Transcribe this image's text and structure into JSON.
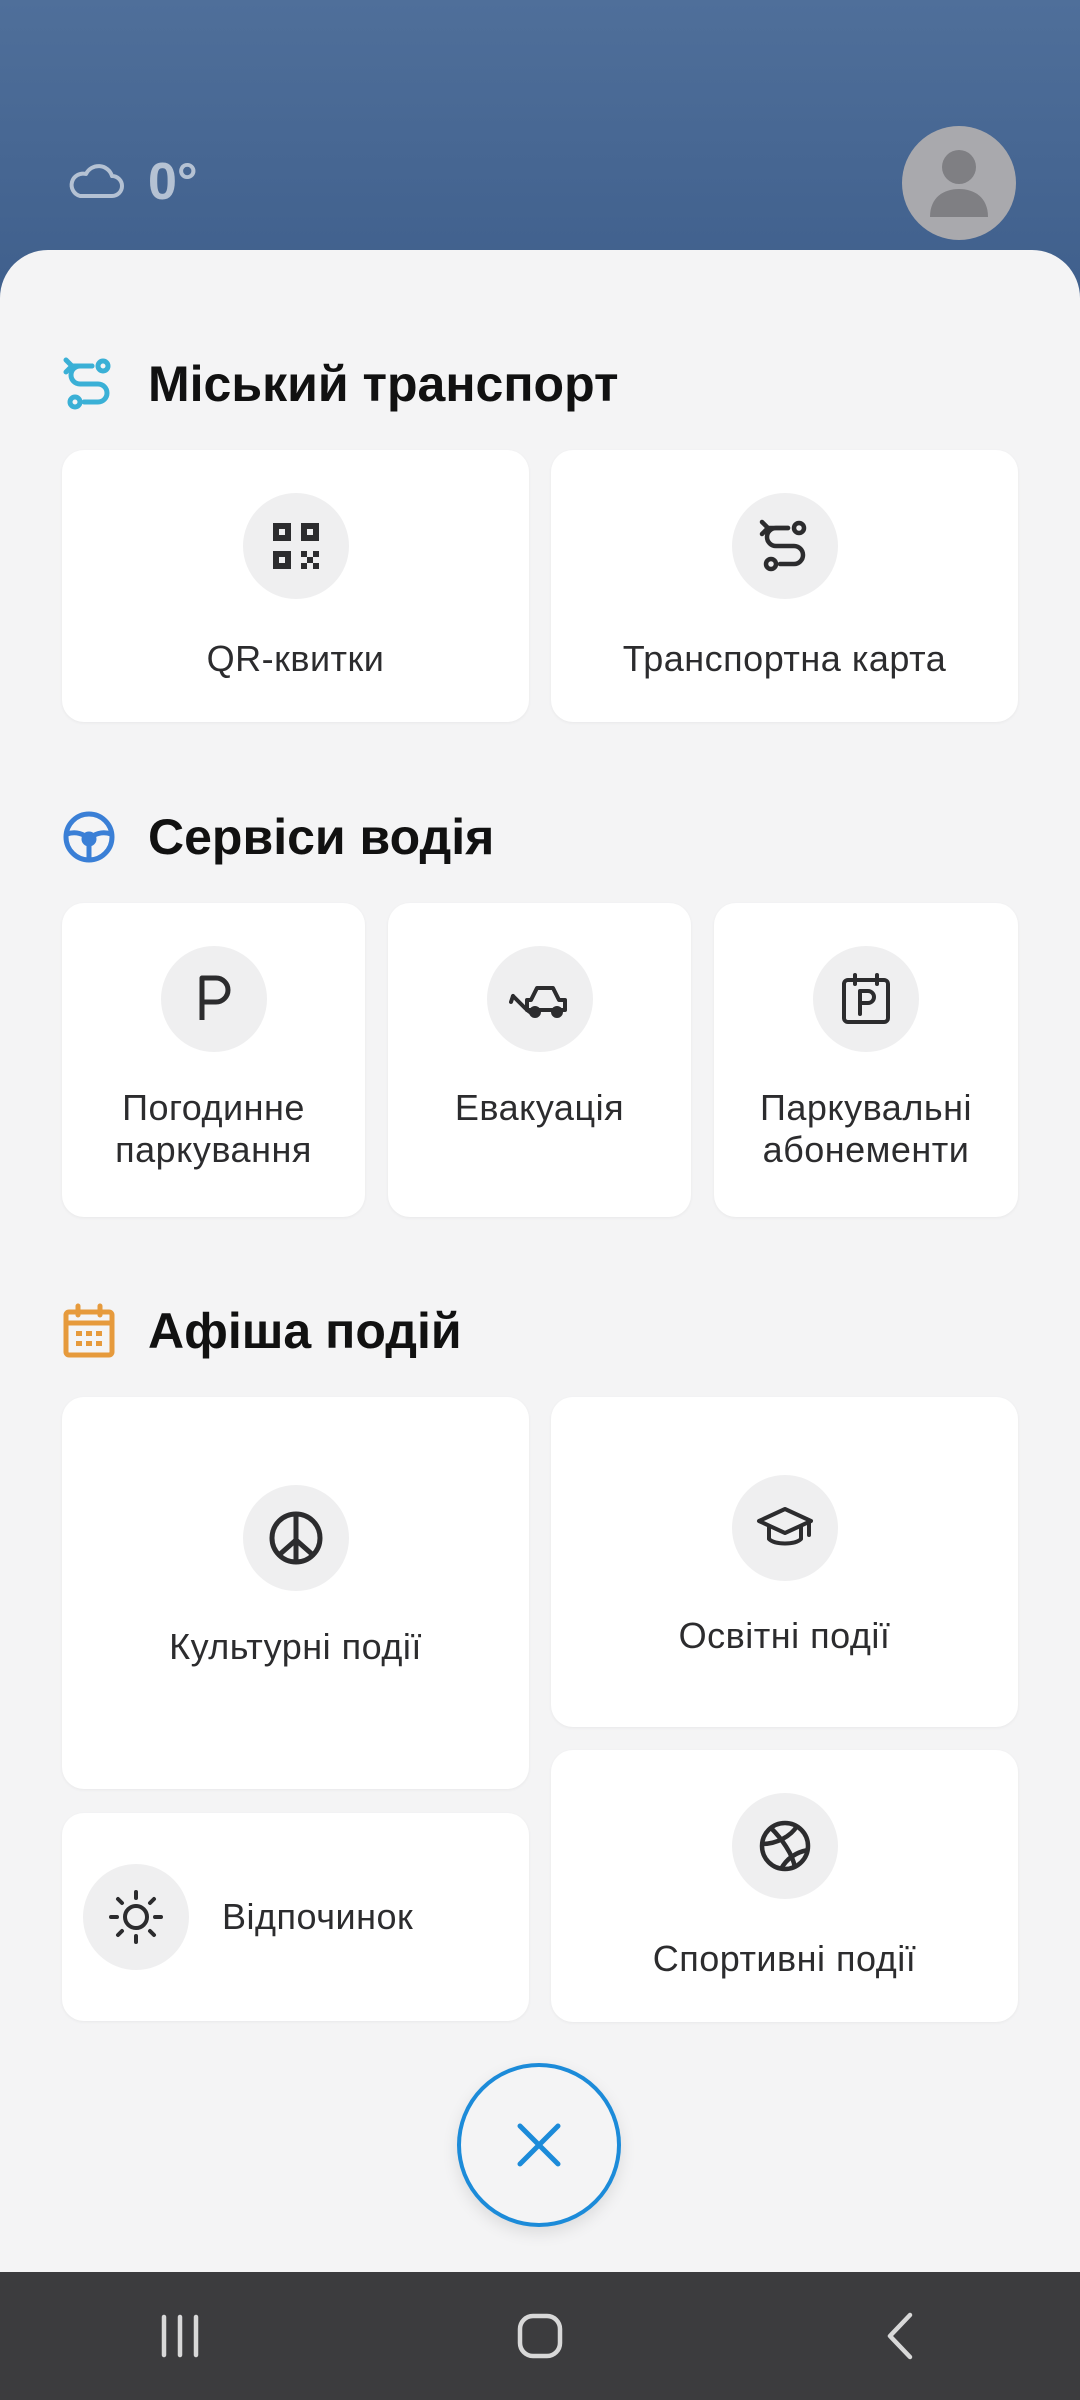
{
  "weather": {
    "temperature": "0°",
    "icon": "cloud-icon"
  },
  "header": {
    "avatar_icon": "user-avatar-icon"
  },
  "sections": {
    "transport": {
      "title": "Міський транспорт",
      "icon": "route-icon",
      "accent": "#3ab0d6",
      "cards": [
        {
          "label": "QR-квитки",
          "icon": "qr-code-icon"
        },
        {
          "label": "Транспортна карта",
          "icon": "route-icon"
        }
      ]
    },
    "driver": {
      "title": "Сервіси водія",
      "icon": "steering-wheel-icon",
      "accent": "#3a7fd6",
      "cards": [
        {
          "label": "Погодинне паркування",
          "icon": "parking-icon"
        },
        {
          "label": "Евакуація",
          "icon": "tow-truck-icon"
        },
        {
          "label": "Паркувальні абонементи",
          "icon": "parking-calendar-icon"
        }
      ]
    },
    "events": {
      "title": "Афіша подій",
      "icon": "calendar-icon",
      "accent": "#e69a3c",
      "cards": [
        {
          "label": "Культурні події",
          "icon": "peace-icon"
        },
        {
          "label": "Освітні події",
          "icon": "graduation-cap-icon"
        },
        {
          "label": "Відпочинок",
          "icon": "sun-icon"
        },
        {
          "label": "Спортивні події",
          "icon": "basketball-icon"
        }
      ]
    }
  },
  "fab": {
    "icon": "close-icon",
    "color": "#1c8bd9"
  },
  "navbar": {
    "items": [
      "recent-apps-icon",
      "home-icon",
      "back-icon"
    ]
  }
}
